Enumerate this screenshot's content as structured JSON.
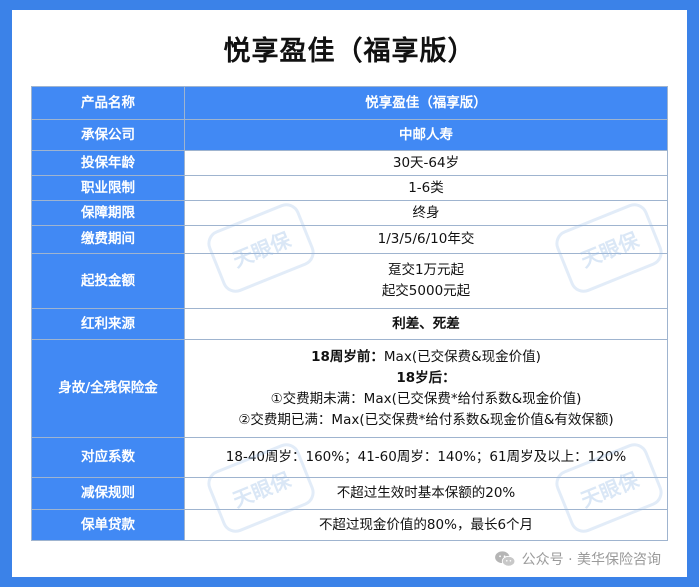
{
  "title": "悦享盈佳（福享版）",
  "rows": [
    {
      "label": "产品名称",
      "lines": [
        {
          "text": "悦享盈佳（福享版）"
        }
      ]
    },
    {
      "label": "承保公司",
      "lines": [
        {
          "text": "中邮人寿"
        }
      ]
    },
    {
      "label": "投保年龄",
      "lines": [
        {
          "text": "30天-64岁"
        }
      ]
    },
    {
      "label": "职业限制",
      "lines": [
        {
          "text": "1-6类"
        }
      ]
    },
    {
      "label": "保障期限",
      "lines": [
        {
          "text": "终身"
        }
      ]
    },
    {
      "label": "缴费期间",
      "lines": [
        {
          "text": "1/3/5/6/10年交"
        }
      ]
    },
    {
      "label": "起投金额",
      "lines": [
        {
          "text": "趸交1万元起"
        },
        {
          "text": "起交5000元起"
        }
      ]
    },
    {
      "label": "红利来源",
      "lines": [
        {
          "text": "利差、死差"
        }
      ]
    },
    {
      "label": "身故/全残保险金",
      "lines": [
        {
          "bold": "18周岁前：",
          "text": "Max(已交保费&现金价值)"
        },
        {
          "bold": "18岁后：",
          "text": ""
        },
        {
          "text": "①交费期未满：Max(已交保费*给付系数&现金价值)"
        },
        {
          "text": "②交费期已满：Max(已交保费*给付系数&现金价值&有效保额)"
        }
      ]
    },
    {
      "label": "对应系数",
      "lines": [
        {
          "text": "18-40周岁：160%；41-60周岁：140%；61周岁及以上：120%"
        }
      ]
    },
    {
      "label": "减保规则",
      "lines": [
        {
          "text": "不超过生效时基本保额的20%"
        }
      ]
    },
    {
      "label": "保单贷款",
      "lines": [
        {
          "text": "不超过现金价值的80%，最长6个月"
        }
      ]
    }
  ],
  "watermark_text": "天眼保",
  "footer": {
    "text": "公众号 · 美华保险咨询",
    "icon": "wechat-icon"
  },
  "colors": {
    "header_blue": "#4189f4",
    "frame_blue": "#3b82e8",
    "border": "#9fb4cf"
  }
}
